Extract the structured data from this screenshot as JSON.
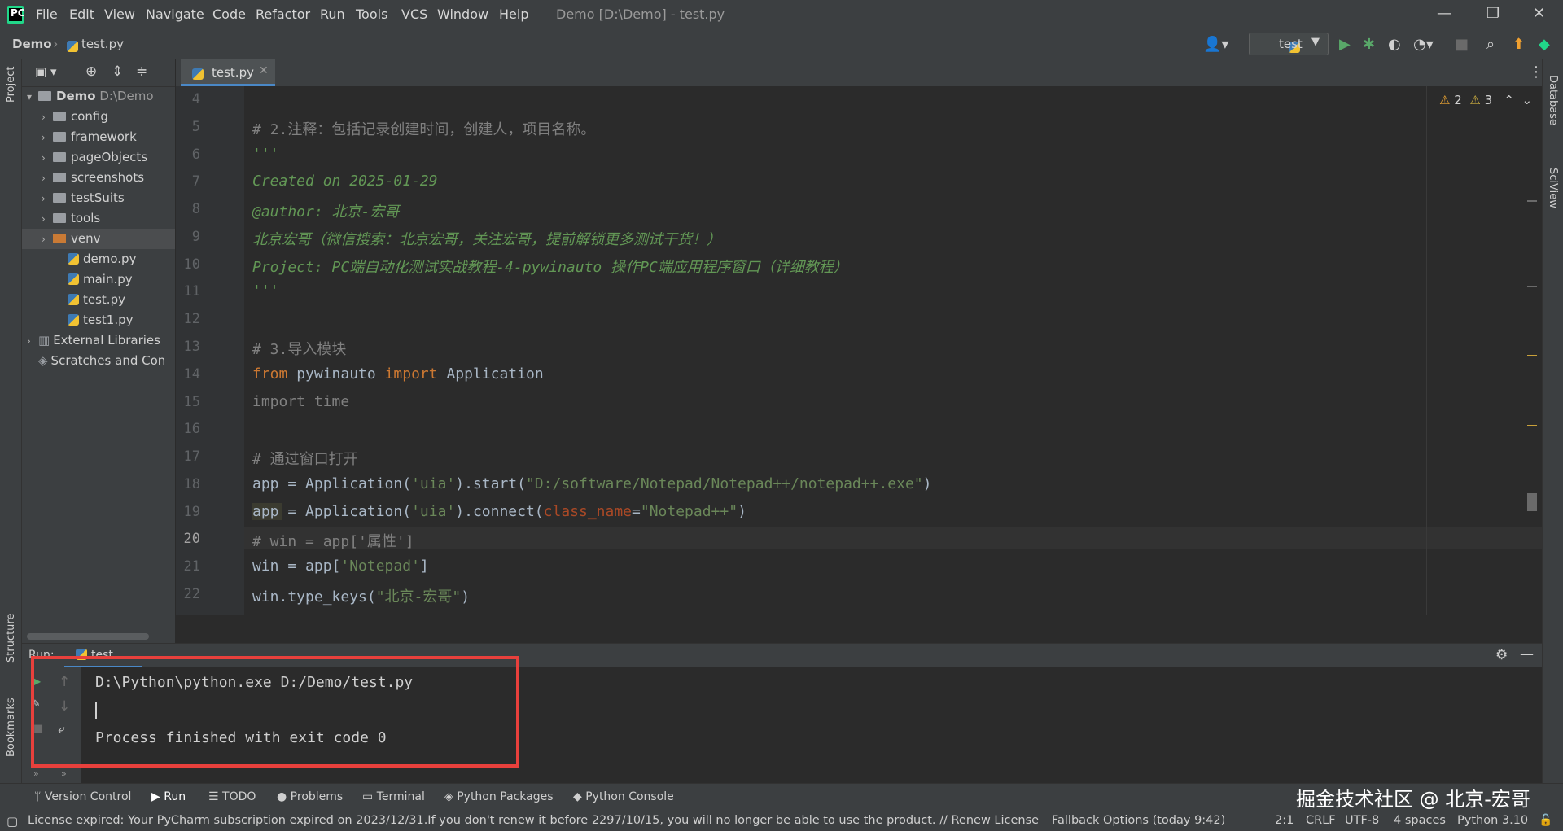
{
  "window": {
    "title": "Demo [D:\\Demo] - test.py",
    "menu": [
      "File",
      "Edit",
      "View",
      "Navigate",
      "Code",
      "Refactor",
      "Run",
      "Tools",
      "VCS",
      "Window",
      "Help"
    ]
  },
  "navbar": {
    "project": "Demo",
    "file": "test.py",
    "run_config": "test"
  },
  "tool_windows": {
    "left": [
      "Project",
      "Structure",
      "Bookmarks"
    ],
    "right": [
      "Database",
      "SciView"
    ]
  },
  "project_tree": {
    "root_name": "Demo",
    "root_path": "D:\\Demo",
    "items": [
      {
        "label": "config",
        "type": "folder"
      },
      {
        "label": "framework",
        "type": "folder"
      },
      {
        "label": "pageObjects",
        "type": "folder"
      },
      {
        "label": "screenshots",
        "type": "folder"
      },
      {
        "label": "testSuits",
        "type": "folder"
      },
      {
        "label": "tools",
        "type": "folder"
      },
      {
        "label": "venv",
        "type": "folder-venv"
      },
      {
        "label": "demo.py",
        "type": "file"
      },
      {
        "label": "main.py",
        "type": "file"
      },
      {
        "label": "test.py",
        "type": "file"
      },
      {
        "label": "test1.py",
        "type": "file"
      }
    ],
    "external_libraries": "External Libraries",
    "scratches": "Scratches and Con"
  },
  "editor": {
    "tab": "test.py",
    "warnings": "2",
    "weak_warnings": "3",
    "lines": [
      {
        "n": "4",
        "t": ""
      },
      {
        "n": "5",
        "t": "# 2.注释：包括记录创建时间，创建人，项目名称。"
      },
      {
        "n": "6",
        "t": "'''"
      },
      {
        "n": "7",
        "t": "Created on 2025-01-29"
      },
      {
        "n": "8",
        "t": "@author: 北京-宏哥"
      },
      {
        "n": "9",
        "t": "北京宏哥（微信搜索：北京宏哥，关注宏哥，提前解锁更多测试干货！）"
      },
      {
        "n": "10",
        "t": "Project: PC端自动化测试实战教程-4-pywinauto 操作PC端应用程序窗口（详细教程）"
      },
      {
        "n": "11",
        "t": "'''"
      },
      {
        "n": "12",
        "t": ""
      },
      {
        "n": "13",
        "t": "# 3.导入模块"
      },
      {
        "n": "14",
        "kw1": "from",
        "mid": " pywinauto ",
        "kw2": "import",
        "rest": " Application"
      },
      {
        "n": "15",
        "t": "import time"
      },
      {
        "n": "16",
        "t": ""
      },
      {
        "n": "17",
        "t": "# 通过窗口打开"
      },
      {
        "n": "18",
        "a": "app = Application(",
        "s1": "'uia'",
        "b": ").start(",
        "s2": "\"D:/software/Notepad/Notepad++/notepad++.exe\"",
        "c": ")"
      },
      {
        "n": "19",
        "a": "app = Application(",
        "s1": "'uia'",
        "b": ").connect(",
        "p": "class_name",
        "eq": "=",
        "s2": "\"Notepad++\"",
        "c": ")"
      },
      {
        "n": "20",
        "t": "# win = app['属性']"
      },
      {
        "n": "21",
        "a": "win = app[",
        "s1": "'Notepad'",
        "c": "]"
      },
      {
        "n": "22",
        "a": "win.type_keys(",
        "s1": "\"北京-宏哥\"",
        "c": ")"
      }
    ]
  },
  "run_panel": {
    "tab_run": "Run:",
    "tab_config": "test",
    "output": [
      "D:\\Python\\python.exe D:/Demo/test.py",
      "",
      "Process finished with exit code 0"
    ]
  },
  "bottom_tools": [
    "Version Control",
    "Run",
    "TODO",
    "Problems",
    "Terminal",
    "Python Packages",
    "Python Console"
  ],
  "status": {
    "message": "License expired: Your PyCharm subscription expired on 2023/12/31.If you don't renew it before 2297/10/15, you will no longer be able to use the product. // Renew License",
    "fallback": "Fallback Options (today 9:42)",
    "position": "2:1",
    "line_sep": "CRLF",
    "encoding": "UTF-8",
    "indent": "4 spaces",
    "interpreter": "Python 3.10"
  },
  "watermark": "掘金技术社区 @ 北京-宏哥",
  "colors": {
    "accent": "#4a88c7",
    "highlight_box": "#e8403c",
    "doc": "#629755",
    "keyword": "#cc7832",
    "string": "#6a8759"
  }
}
